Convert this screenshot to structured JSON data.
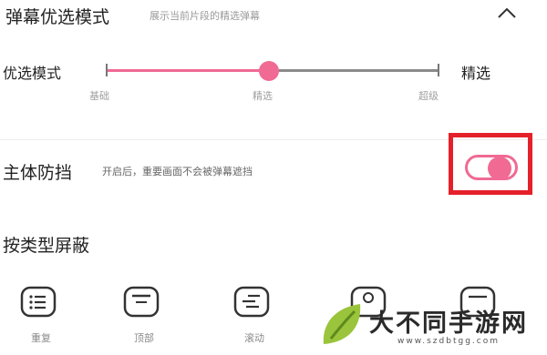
{
  "header": {
    "title": "弹幕优选模式",
    "description": "展示当前片段的精选弹幕"
  },
  "mode": {
    "label": "优选模式",
    "right_label": "精选",
    "levels": [
      "基础",
      "精选",
      "超级"
    ],
    "selected_index": 1
  },
  "protection": {
    "title": "主体防挡",
    "description": "开启后，重要画面不会被弹幕遮挡",
    "enabled": true
  },
  "block_by_type": {
    "title": "按类型屏蔽",
    "items": [
      {
        "label": "重复",
        "icon": "repeat-list-icon"
      },
      {
        "label": "顶部",
        "icon": "top-comment-icon"
      },
      {
        "label": "滚动",
        "icon": "scroll-comment-icon"
      },
      {
        "label": "",
        "icon": "color-comment-icon"
      },
      {
        "label": "",
        "icon": "bottom-comment-icon"
      }
    ]
  },
  "colors": {
    "accent": "#f06a93",
    "highlight": "#e4212b"
  },
  "watermark": {
    "text": "大不同手游网",
    "url": "www.szdbtgg.com"
  }
}
